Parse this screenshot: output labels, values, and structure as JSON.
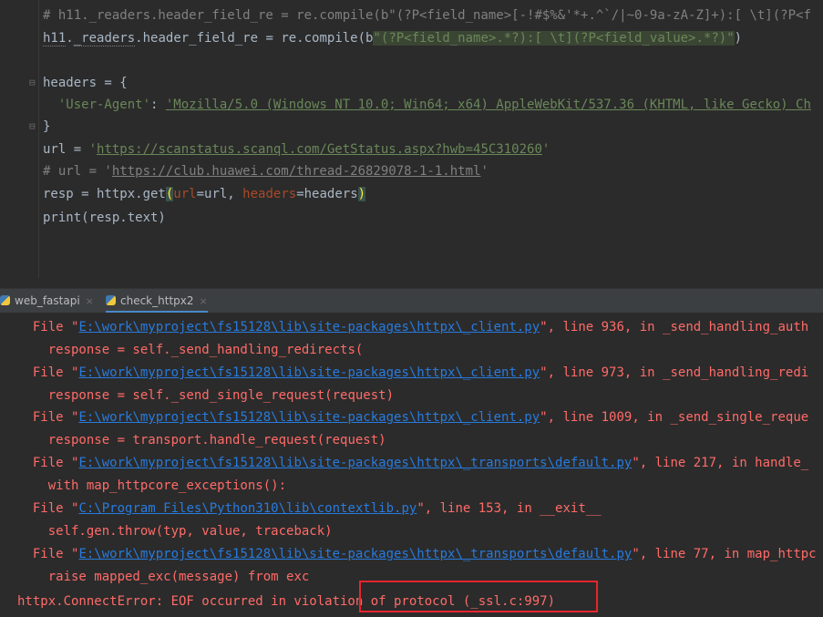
{
  "editor": {
    "lines": {
      "l1_comment": "# h11._readers.header_field_re = re.compile(b\"(?P<field_name>[-!#$%&'*+.^`/|~0-9a-zA-Z]+):[ \\t](?P<f",
      "l2_a": "h11",
      "l2_b": ".",
      "l2_c": "_readers",
      "l2_d": ".header_field_re = re.compile(b",
      "l2_e": "\"(?P<field_name>.*?):[ \\t](?P<field_value>.*?)\"",
      "l2_f": ")",
      "l4": "headers = {",
      "l5_key": "'User-Agent'",
      "l5_colon": ": ",
      "l5_val": "'Mozilla/5.0 (Windows NT 10.0; Win64; x64) AppleWebKit/537.36 (KHTML, like Gecko) Ch",
      "l6": "}",
      "l7_a": "url = ",
      "l7_q1": "'",
      "l7_url": "https://scanstatus.scanql.com/GetStatus.aspx?hwb=45C310260",
      "l7_q2": "'",
      "l8_a": "# url = '",
      "l8_url": "https://club.huawei.com/thread-26829078-1-1.html",
      "l8_b": "'",
      "l9_a": "resp = httpx.get",
      "l9_open": "(",
      "l9_p1": "url",
      "l9_b": "=url, ",
      "l9_p2": "headers",
      "l9_c": "=headers",
      "l9_close": ")",
      "l10": "print(resp.text)"
    }
  },
  "tabs": [
    {
      "label": "web_fastapi",
      "close": "×"
    },
    {
      "label": "check_httpx2",
      "close": "×"
    }
  ],
  "console": {
    "file_prefix": "File \"",
    "file_suffix_close": "\"",
    "f1_path": "E:\\work\\myproject\\fs15128\\lib\\site-packages\\httpx\\_client.py",
    "f1_rest": ", line 936, in _send_handling_auth",
    "c1": "response = self._send_handling_redirects(",
    "f2_path": "E:\\work\\myproject\\fs15128\\lib\\site-packages\\httpx\\_client.py",
    "f2_rest": ", line 973, in _send_handling_redi",
    "c2": "response = self._send_single_request(request)",
    "f3_path": "E:\\work\\myproject\\fs15128\\lib\\site-packages\\httpx\\_client.py",
    "f3_rest": ", line 1009, in _send_single_reque",
    "c3": "response = transport.handle_request(request)",
    "f4_path": "E:\\work\\myproject\\fs15128\\lib\\site-packages\\httpx\\_transports\\default.py",
    "f4_rest": ", line 217, in handle_",
    "c4": "with map_httpcore_exceptions():",
    "f5_path": "C:\\Program Files\\Python310\\lib\\contextlib.py",
    "f5_rest": ", line 153, in __exit__",
    "c5": "self.gen.throw(typ, value, traceback)",
    "f6_path": "E:\\work\\myproject\\fs15128\\lib\\site-packages\\httpx\\_transports\\default.py",
    "f6_rest": ", line 77, in map_httpc",
    "c6": "raise mapped_exc(message) from exc",
    "error": "httpx.ConnectError: EOF occurred in violation of protocol (_ssl.c:997)"
  },
  "colors": {
    "editor_bg": "#2b2b2b",
    "error_red": "#ff6b68",
    "link_blue": "#287bde",
    "highlight_box": "#e8252d"
  }
}
